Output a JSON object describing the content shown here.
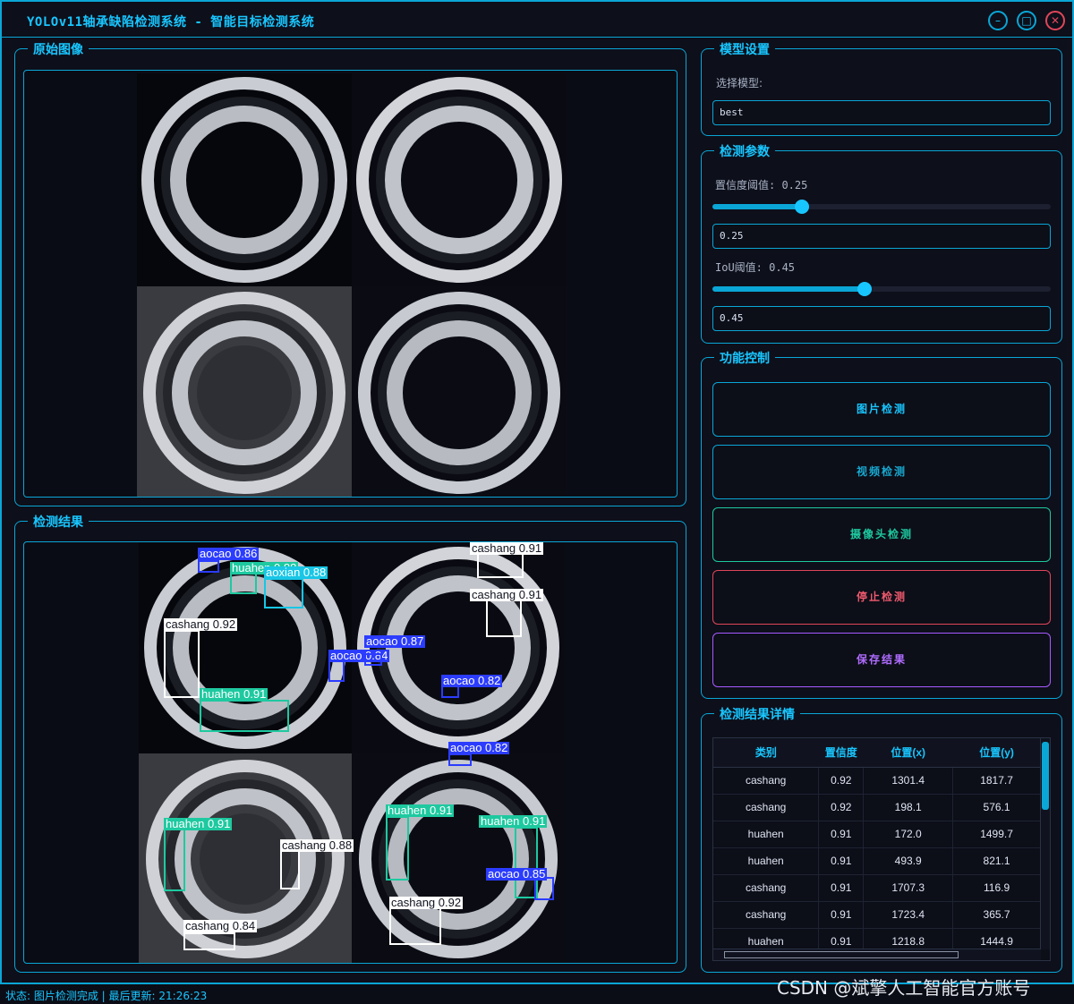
{
  "window": {
    "title": "YOLOv11轴承缺陷检测系统 - 智能目标检测系统",
    "controls": [
      "minimize-icon",
      "maximize-icon",
      "close-icon"
    ]
  },
  "panels": {
    "original": {
      "title": "原始图像"
    },
    "result": {
      "title": "检测结果"
    },
    "model": {
      "title": "模型设置",
      "select_label": "选择模型:",
      "selected_model": "best"
    },
    "params": {
      "title": "检测参数",
      "conf_label": "置信度阈值: 0.25",
      "conf_value": "0.25",
      "conf_level": 0.25,
      "iou_label": "IoU阈值: 0.45",
      "iou_value": "0.45",
      "iou_level": 0.45
    },
    "controls": {
      "title": "功能控制",
      "buttons": {
        "image_detect": "图片检测",
        "video_detect": "视频检测",
        "camera_detect": "摄像头检测",
        "stop_detect": "停止检测",
        "save_result": "保存结果"
      }
    },
    "details": {
      "title": "检测结果详情",
      "columns": [
        "类别",
        "置信度",
        "位置(x)",
        "位置(y)"
      ],
      "rows": [
        [
          "cashang",
          "0.92",
          "1301.4",
          "1817.7"
        ],
        [
          "cashang",
          "0.92",
          "198.1",
          "576.1"
        ],
        [
          "huahen",
          "0.91",
          "172.0",
          "1499.7"
        ],
        [
          "huahen",
          "0.91",
          "493.9",
          "821.1"
        ],
        [
          "cashang",
          "0.91",
          "1707.3",
          "116.9"
        ],
        [
          "cashang",
          "0.91",
          "1723.4",
          "365.7"
        ],
        [
          "huahen",
          "0.91",
          "1218.8",
          "1444.9"
        ]
      ]
    }
  },
  "detections": [
    "aocao 0.86",
    "huahen 0.88",
    "aoxian 0.88",
    "cashang 0.92",
    "huahen 0.91",
    "aocao 0.84",
    "cashang 0.91",
    "cashang 0.91",
    "aocao 0.87",
    "aocao 0.82",
    "aocao 0.82",
    "huahen 0.91",
    "cashang 0.88",
    "cashang 0.84",
    "huahen 0.91",
    "huahen 0.91",
    "aocao 0.85",
    "cashang 0.92"
  ],
  "status": {
    "text": "状态: 图片检测完成 | 最后更新: 21:26:23"
  },
  "watermark": "CSDN @斌擎人工智能官方账号",
  "colors": {
    "accent": "#0aa6d6",
    "stop": "#e0465a",
    "camera": "#1ec9a0",
    "save": "#a65bff"
  }
}
